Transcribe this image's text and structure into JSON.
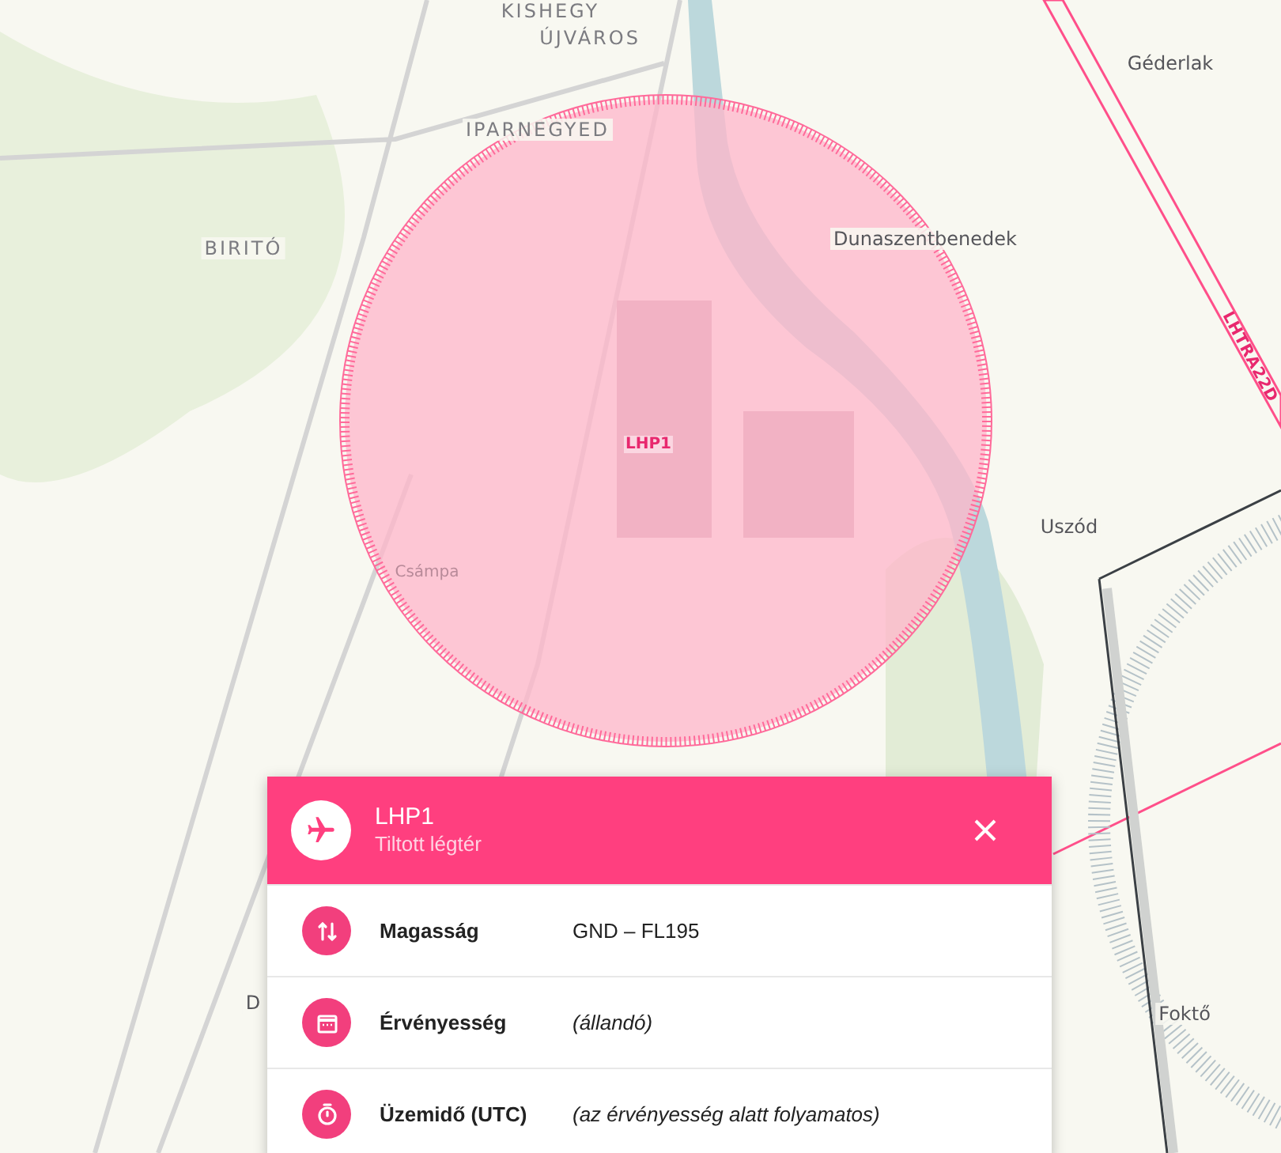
{
  "map": {
    "labels": [
      {
        "text": "KISHEGY",
        "kind": "district"
      },
      {
        "text": "ÚJVÁROS",
        "kind": "district"
      },
      {
        "text": "IPARNEGYED",
        "kind": "district"
      },
      {
        "text": "BIRITÓ",
        "kind": "district"
      },
      {
        "text": "Géderlak",
        "kind": "town"
      },
      {
        "text": "Dunaszentbenedek",
        "kind": "town"
      },
      {
        "text": "Uszód",
        "kind": "town"
      },
      {
        "text": "Csámpa",
        "kind": "faded"
      },
      {
        "text": "D",
        "kind": "town"
      },
      {
        "text": "Foktő",
        "kind": "town"
      },
      {
        "text": "LHP1",
        "kind": "zone"
      },
      {
        "text": "LHTRA22D",
        "kind": "corridor"
      }
    ]
  },
  "panel": {
    "title": "LHP1",
    "subtitle": "Tiltott légtér",
    "rows": [
      {
        "kind": "altitude",
        "label": "Magasság",
        "value": "GND – FL195",
        "italic": false
      },
      {
        "kind": "validity",
        "label": "Érvényesség",
        "value": "(állandó)",
        "italic": true
      },
      {
        "kind": "schedule",
        "label": "Üzemidő (UTC)",
        "value": "(az érvényesség alatt folyamatos)",
        "italic": true
      }
    ]
  }
}
